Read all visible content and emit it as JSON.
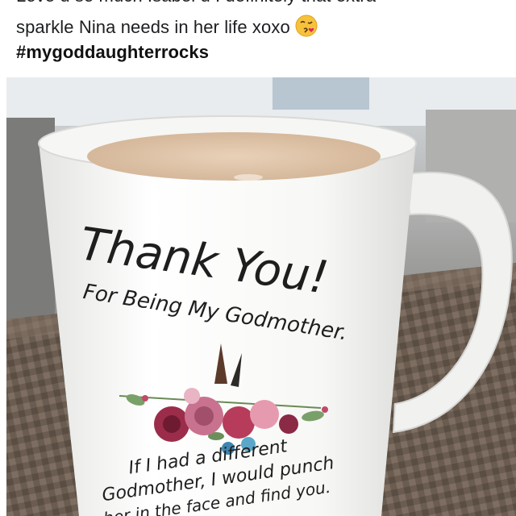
{
  "post": {
    "line1_clipped": "Love u so much Isabel u I definitely that extra",
    "line2": "sparkle Nina needs in her life xoxo",
    "hashtag": "#mygoddaughterrocks",
    "emoji": "face-blowing-a-kiss-icon"
  },
  "photo": {
    "mug_title": "Thank You!",
    "mug_subtitle": "For Being My Godmother.",
    "mug_line1": "If I had a different",
    "mug_line2": "Godmother, I would punch",
    "mug_line3": "her in the face and find you."
  }
}
